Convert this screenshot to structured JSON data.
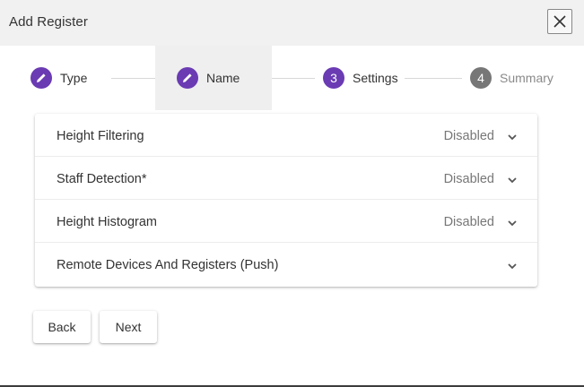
{
  "dialog": {
    "title": "Add Register",
    "close_icon": "close-icon"
  },
  "stepper": {
    "steps": [
      {
        "label": "Type",
        "state": "done",
        "icon": "pencil-icon",
        "number": ""
      },
      {
        "label": "Name",
        "state": "done",
        "icon": "pencil-icon",
        "number": ""
      },
      {
        "label": "Settings",
        "state": "current",
        "icon": "",
        "number": "3"
      },
      {
        "label": "Summary",
        "state": "pending",
        "icon": "",
        "number": "4"
      }
    ]
  },
  "panels": [
    {
      "title": "Height Filtering",
      "status": "Disabled",
      "icon": "chevron-down-icon"
    },
    {
      "title": "Staff Detection*",
      "status": "Disabled",
      "icon": "chevron-down-icon"
    },
    {
      "title": "Height Histogram",
      "status": "Disabled",
      "icon": "chevron-down-icon"
    },
    {
      "title": "Remote Devices And Registers (Push)",
      "status": "",
      "icon": "chevron-down-icon"
    }
  ],
  "actions": {
    "back_label": "Back",
    "next_label": "Next"
  },
  "colors": {
    "accent": "#6a3bb3",
    "pending": "#777777",
    "titlebar_bg": "#f1f1f1",
    "active_step_bg": "#efefef"
  }
}
